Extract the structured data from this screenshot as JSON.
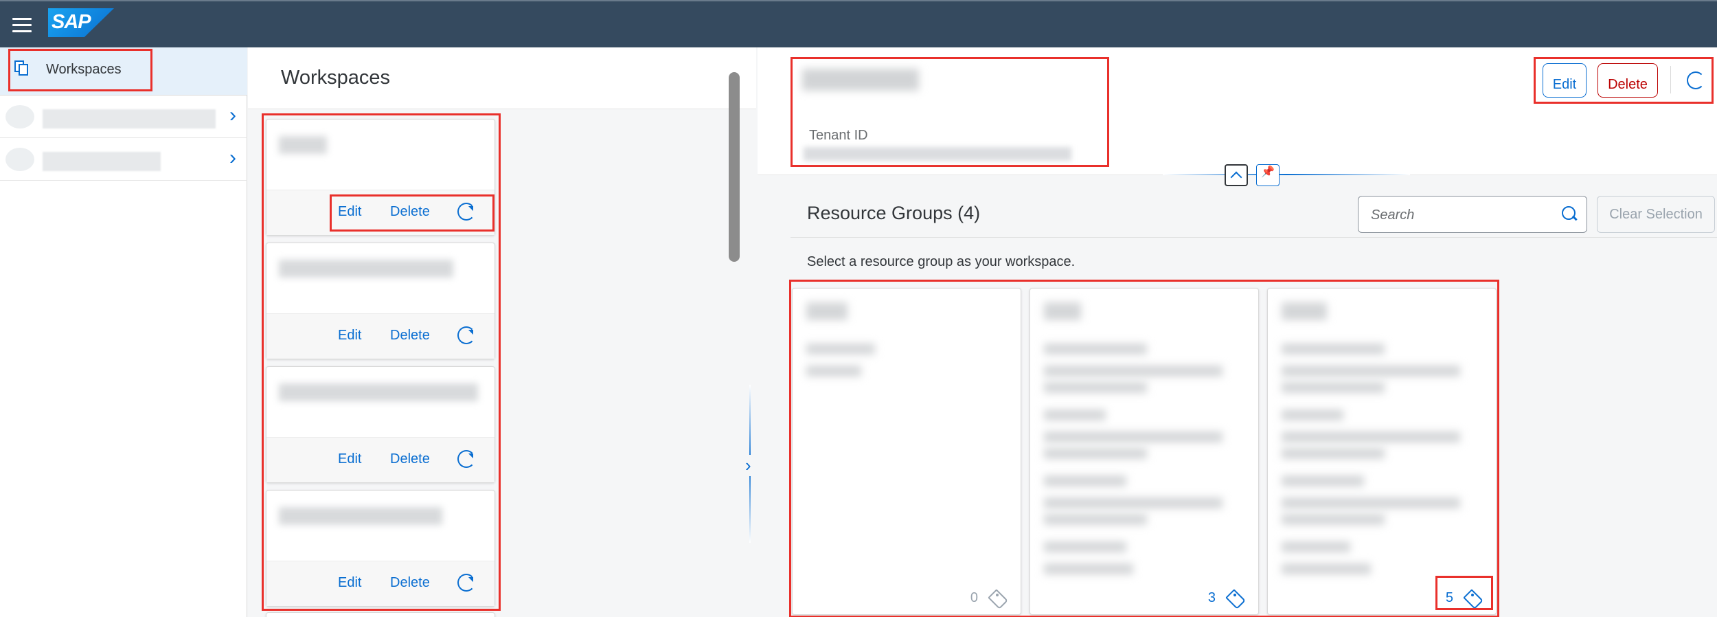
{
  "shell": {
    "logo_text": "SAP"
  },
  "sidenav": {
    "items": [
      {
        "label": "Workspaces",
        "icon": "copy-icon"
      }
    ]
  },
  "workspaces": {
    "title": "Workspaces",
    "cards": [
      {
        "edit": "Edit",
        "delete": "Delete"
      },
      {
        "edit": "Edit",
        "delete": "Delete"
      },
      {
        "edit": "Edit",
        "delete": "Delete"
      },
      {
        "edit": "Edit",
        "delete": "Delete"
      }
    ]
  },
  "detail": {
    "tenant_label": "Tenant ID",
    "edit": "Edit",
    "delete": "Delete",
    "resource_groups_title": "Resource Groups (4)",
    "search_placeholder": "Search",
    "clear_selection": "Clear Selection",
    "description": "Select a resource group as your workspace.",
    "tiles": [
      {
        "count": "0"
      },
      {
        "count": "3"
      },
      {
        "count": "5"
      }
    ]
  },
  "colors": {
    "accent": "#0a6ed1",
    "shell": "#354a5f",
    "destructive": "#bb0000",
    "highlight": "#e9302b"
  }
}
